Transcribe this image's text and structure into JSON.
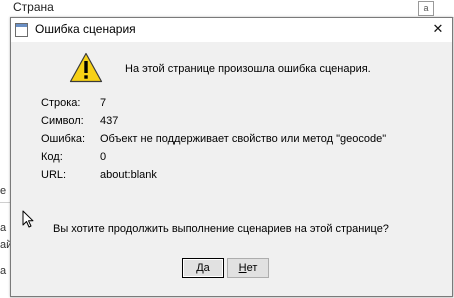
{
  "background": {
    "field_label": "Страна",
    "field_button": "a",
    "fragments": [
      "е",
      "а",
      "ай",
      "а"
    ]
  },
  "dialog": {
    "title": "Ошибка сценария",
    "close_glyph": "✕",
    "headline": "На этой странице произошла ошибка сценария.",
    "details": [
      {
        "label": "Строка:",
        "value": "7"
      },
      {
        "label": "Символ:",
        "value": "437"
      },
      {
        "label": "Ошибка:",
        "value": "Объект не поддерживает свойство или метод \"geocode\""
      },
      {
        "label": "Код:",
        "value": "0"
      },
      {
        "label": "URL:",
        "value": "about:blank"
      }
    ],
    "question": "Вы хотите продолжить выполнение сценариев на этой странице?",
    "yes_mnemonic": "Д",
    "yes_rest": "а",
    "no_mnemonic": "Н",
    "no_rest": "ет"
  },
  "icons": {
    "warning": "warning-triangle",
    "cursor": "mouse-pointer"
  },
  "colors": {
    "warning_fill": "#f7d116",
    "dialog_bg": "#f0f0f0",
    "titlebar_bg": "#ffffff"
  }
}
